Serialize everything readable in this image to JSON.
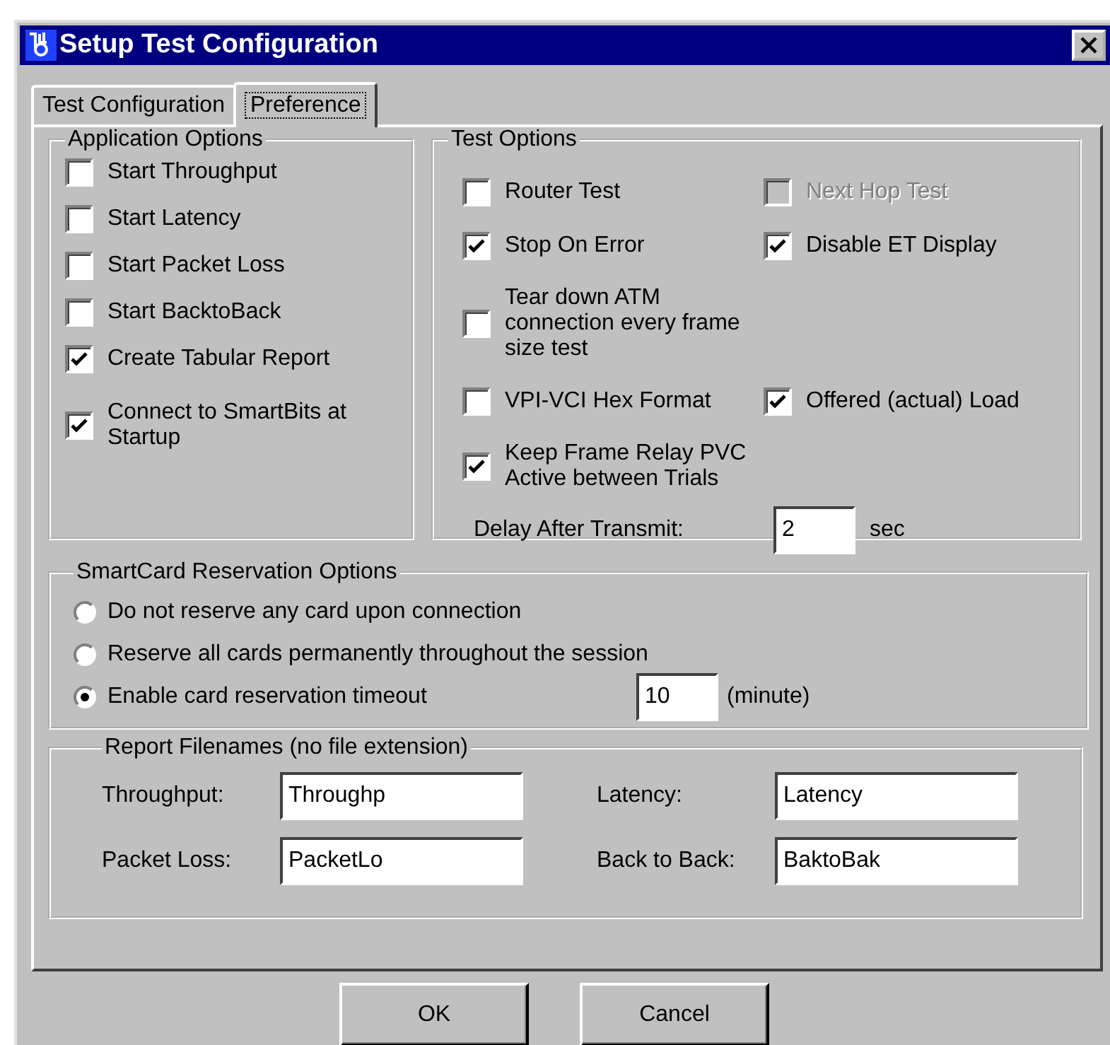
{
  "window": {
    "title": "Setup Test Configuration"
  },
  "tabs": [
    {
      "label": "Test Configuration",
      "selected": false
    },
    {
      "label": "Preference",
      "selected": true
    }
  ],
  "application_options": {
    "title": "Application Options",
    "items": [
      {
        "label": "Start Throughput",
        "checked": false
      },
      {
        "label": "Start Latency",
        "checked": false
      },
      {
        "label": "Start Packet Loss",
        "checked": false
      },
      {
        "label": "Start BacktoBack",
        "checked": false
      },
      {
        "label": "Create Tabular Report",
        "checked": true
      },
      {
        "label": "Connect to SmartBits at Startup",
        "checked": true
      }
    ]
  },
  "test_options": {
    "title": "Test Options",
    "rows": [
      [
        {
          "label": "Router Test",
          "checked": false,
          "disabled": false
        },
        {
          "label": "Next Hop Test",
          "checked": false,
          "disabled": true
        }
      ],
      [
        {
          "label": "Stop On Error",
          "checked": true,
          "disabled": false
        },
        {
          "label": "Disable ET Display",
          "checked": true,
          "disabled": false
        }
      ],
      [
        {
          "label": "Tear down ATM connection every frame size test",
          "checked": false,
          "disabled": false
        }
      ],
      [
        {
          "label": "VPI-VCI Hex Format",
          "checked": false,
          "disabled": false
        },
        {
          "label": "Offered (actual) Load",
          "checked": true,
          "disabled": false
        }
      ],
      [
        {
          "label": "Keep Frame Relay PVC Active between Trials",
          "checked": true,
          "disabled": false
        }
      ]
    ],
    "delay": {
      "label": "Delay After Transmit:",
      "value": "2",
      "unit": "sec"
    }
  },
  "smartcard": {
    "title": "SmartCard Reservation Options",
    "options": [
      {
        "label": "Do not reserve any card upon connection",
        "selected": false
      },
      {
        "label": "Reserve all cards permanently throughout the session",
        "selected": false
      },
      {
        "label": "Enable card reservation timeout",
        "selected": true,
        "value": "10",
        "unit": "(minute)"
      }
    ]
  },
  "report_filenames": {
    "title": "Report Filenames (no file extension)",
    "fields": [
      {
        "label": "Throughput:",
        "value": "Throughp"
      },
      {
        "label": "Latency:",
        "value": "Latency"
      },
      {
        "label": "Packet Loss:",
        "value": "PacketLo"
      },
      {
        "label": "Back to Back:",
        "value": "BaktoBak"
      }
    ]
  },
  "buttons": [
    "OK",
    "Cancel"
  ]
}
